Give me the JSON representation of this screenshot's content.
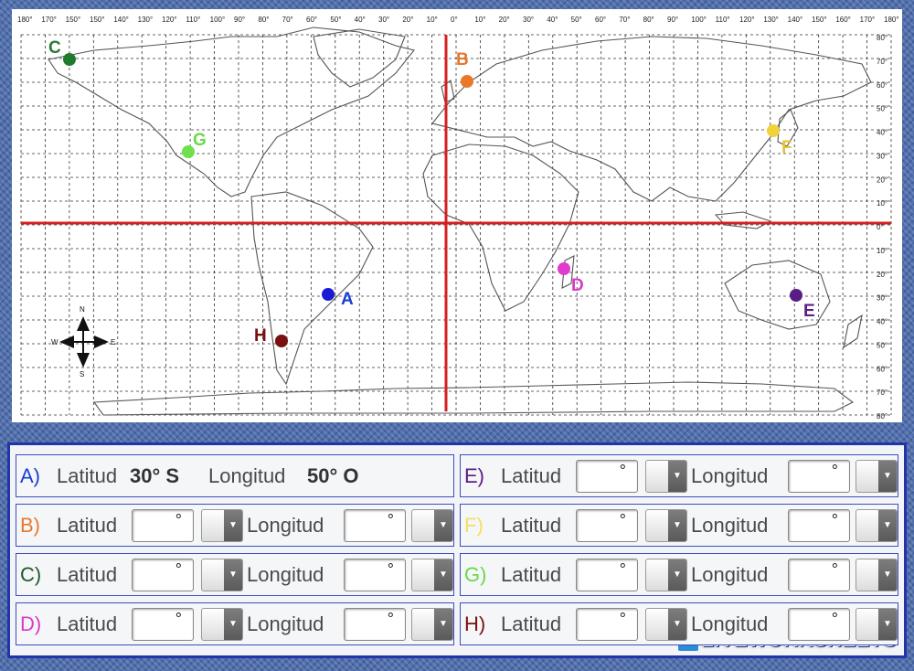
{
  "map": {
    "top_labels": [
      "180°",
      "170°",
      "150°",
      "150°",
      "140°",
      "130°",
      "120°",
      "110°",
      "100°",
      "90°",
      "80°",
      "70°",
      "60°",
      "50°",
      "40°",
      "30°",
      "20°",
      "10°",
      "0°",
      "10°",
      "20°",
      "30°",
      "40°",
      "50°",
      "60°",
      "70°",
      "80°",
      "90°",
      "100°",
      "110°",
      "120°",
      "130°",
      "140°",
      "150°",
      "160°",
      "170°",
      "180°"
    ],
    "right_labels": [
      "80°",
      "70°",
      "60°",
      "50°",
      "40°",
      "30°",
      "20°",
      "10°",
      "0°",
      "10°",
      "20°",
      "30°",
      "40°",
      "50°",
      "60°",
      "70°",
      "80°"
    ],
    "compass": {
      "n": "N",
      "s": "S",
      "e": "E",
      "w": "W"
    },
    "points": [
      {
        "id": "A",
        "color": "#1a1ad6",
        "label_color": "#1a3fd1"
      },
      {
        "id": "B",
        "color": "#e8782a",
        "label_color": "#e8782a"
      },
      {
        "id": "C",
        "color": "#1f7a2e",
        "label_color": "#2a7a33"
      },
      {
        "id": "D",
        "color": "#e23ad0",
        "label_color": "#d93ac8"
      },
      {
        "id": "E",
        "color": "#5a1d86",
        "label_color": "#5a1d86"
      },
      {
        "id": "F",
        "color": "#f1d23a",
        "label_color": "#e3c531"
      },
      {
        "id": "G",
        "color": "#6fe04c",
        "label_color": "#6ad84b"
      },
      {
        "id": "H",
        "color": "#7a1010",
        "label_color": "#7a1010"
      }
    ]
  },
  "worksheet": {
    "latitude_label": "Latitud",
    "longitude_label": "Longitud",
    "degree_symbol": "°",
    "example": {
      "letter": "A)",
      "lat_value": "30° S",
      "lon_value": "50° O"
    },
    "rows": [
      {
        "letter": "B)",
        "color": "#e8782a"
      },
      {
        "letter": "C)",
        "color": "#1f5a2a"
      },
      {
        "letter": "D)",
        "color": "#d93ac8"
      },
      {
        "letter": "E)",
        "color": "#5a1d86"
      },
      {
        "letter": "F)",
        "color": "#f0e060"
      },
      {
        "letter": "G)",
        "color": "#6ad84b"
      },
      {
        "letter": "H)",
        "color": "#7a1010"
      }
    ],
    "example_color": "#1a3fd1"
  },
  "watermark": {
    "text": "LIVEWORKSHEETS",
    "badge": "LW"
  }
}
